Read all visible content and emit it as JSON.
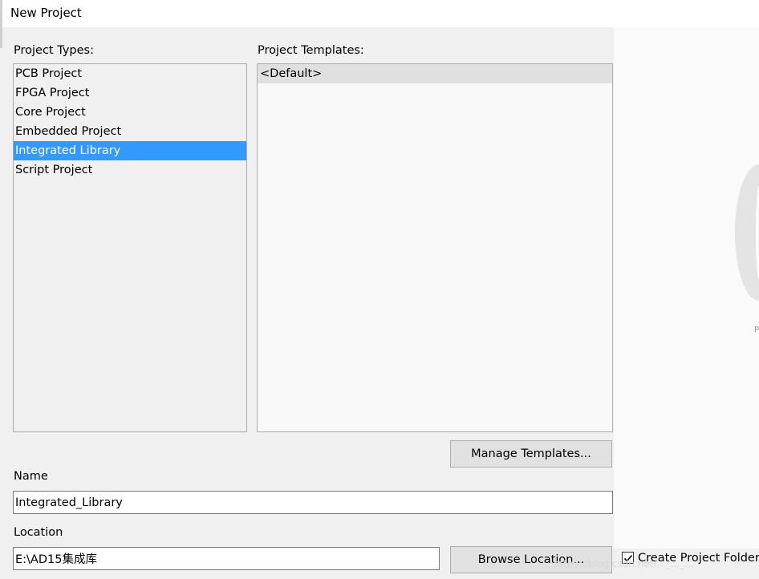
{
  "window": {
    "title": "New Project"
  },
  "project_types": {
    "label": "Project Types:",
    "items": [
      {
        "label": "PCB Project",
        "selected": false
      },
      {
        "label": "FPGA Project",
        "selected": false
      },
      {
        "label": "Core Project",
        "selected": false
      },
      {
        "label": "Embedded Project",
        "selected": false
      },
      {
        "label": "Integrated Library",
        "selected": true
      },
      {
        "label": "Script Project",
        "selected": false
      }
    ]
  },
  "project_templates": {
    "label": "Project Templates:",
    "items": [
      {
        "label": "<Default>",
        "selected": true
      }
    ]
  },
  "buttons": {
    "manage_templates": "Manage Templates...",
    "browse_location": "Browse Location..."
  },
  "name": {
    "label": "Name",
    "value": "Integrated_Library"
  },
  "location": {
    "label": "Location",
    "value": "E:\\AD15集成库"
  },
  "create_folder": {
    "label": "Create Project Folder",
    "checked": true
  },
  "side_panel": {
    "text": "P"
  },
  "watermark": "https://blog.csdn.net/..._..._..."
}
